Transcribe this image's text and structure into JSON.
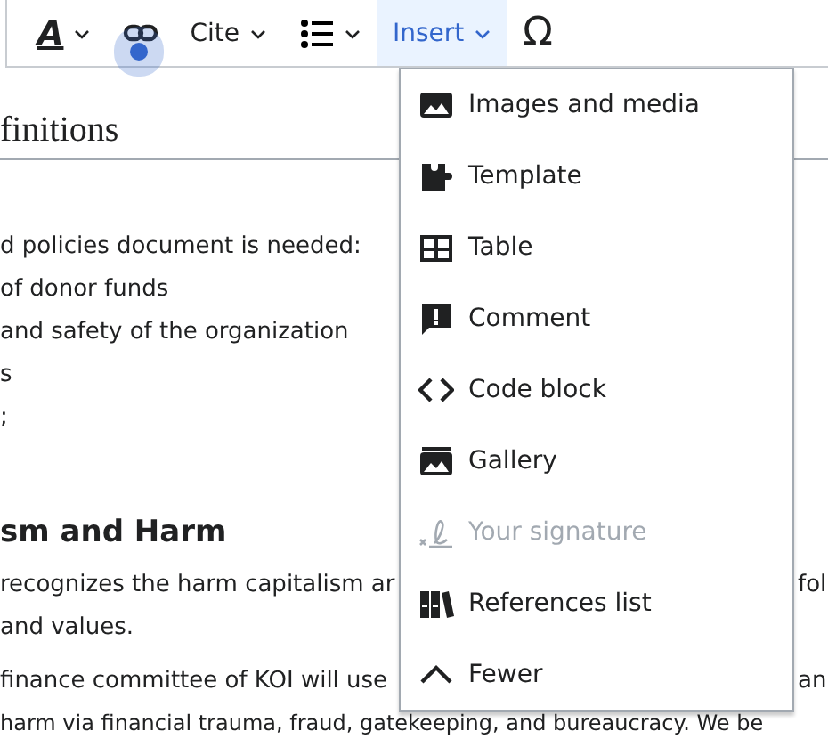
{
  "toolbar": [
    {
      "kind": "text-style",
      "label": "A",
      "dropdown": true,
      "selected": false
    },
    {
      "kind": "link",
      "dropdown": false,
      "selected": false
    },
    {
      "kind": "text",
      "label": "Cite",
      "dropdown": true,
      "selected": false
    },
    {
      "kind": "list",
      "dropdown": true,
      "selected": false
    },
    {
      "kind": "text",
      "label": "Insert",
      "dropdown": true,
      "selected": true
    },
    {
      "kind": "text",
      "label": "Ω",
      "dropdown": false,
      "selected": false
    }
  ],
  "document": {
    "heading": "finitions",
    "lines": [
      {
        "kind": "gap"
      },
      {
        "kind": "text",
        "text": "d policies document is needed:"
      },
      {
        "kind": "item",
        "text": "of donor funds"
      },
      {
        "kind": "item",
        "text": "and safety of the organization"
      },
      {
        "kind": "item",
        "text": "s"
      },
      {
        "kind": "item",
        "text": ";"
      },
      {
        "kind": "gap"
      },
      {
        "kind": "heading",
        "text": "sm and Harm"
      },
      {
        "kind": "text",
        "text": "recognizes the harm capitalism ar",
        "right": "fol"
      },
      {
        "kind": "text",
        "text": "and values."
      },
      {
        "kind": "para",
        "text": "finance committee of KOI will use",
        "right": "an"
      },
      {
        "kind": "text",
        "text": "harm via financial trauma, fraud, gatekeeping, and bureaucracy. We be"
      }
    ]
  },
  "insert_menu": {
    "items": [
      {
        "kind": "image",
        "label": "Images and media",
        "disabled": false
      },
      {
        "kind": "puzzle",
        "label": "Template",
        "disabled": false
      },
      {
        "kind": "table",
        "label": "Table",
        "disabled": false
      },
      {
        "kind": "comment",
        "label": "Comment",
        "disabled": false
      },
      {
        "kind": "code",
        "label": "Code block",
        "disabled": false
      },
      {
        "kind": "gallery",
        "label": "Gallery",
        "disabled": false
      },
      {
        "kind": "signature",
        "label": "Your signature",
        "disabled": true
      },
      {
        "kind": "books",
        "label": "References list",
        "disabled": false
      },
      {
        "kind": "up",
        "label": "Fewer",
        "disabled": false
      }
    ]
  }
}
